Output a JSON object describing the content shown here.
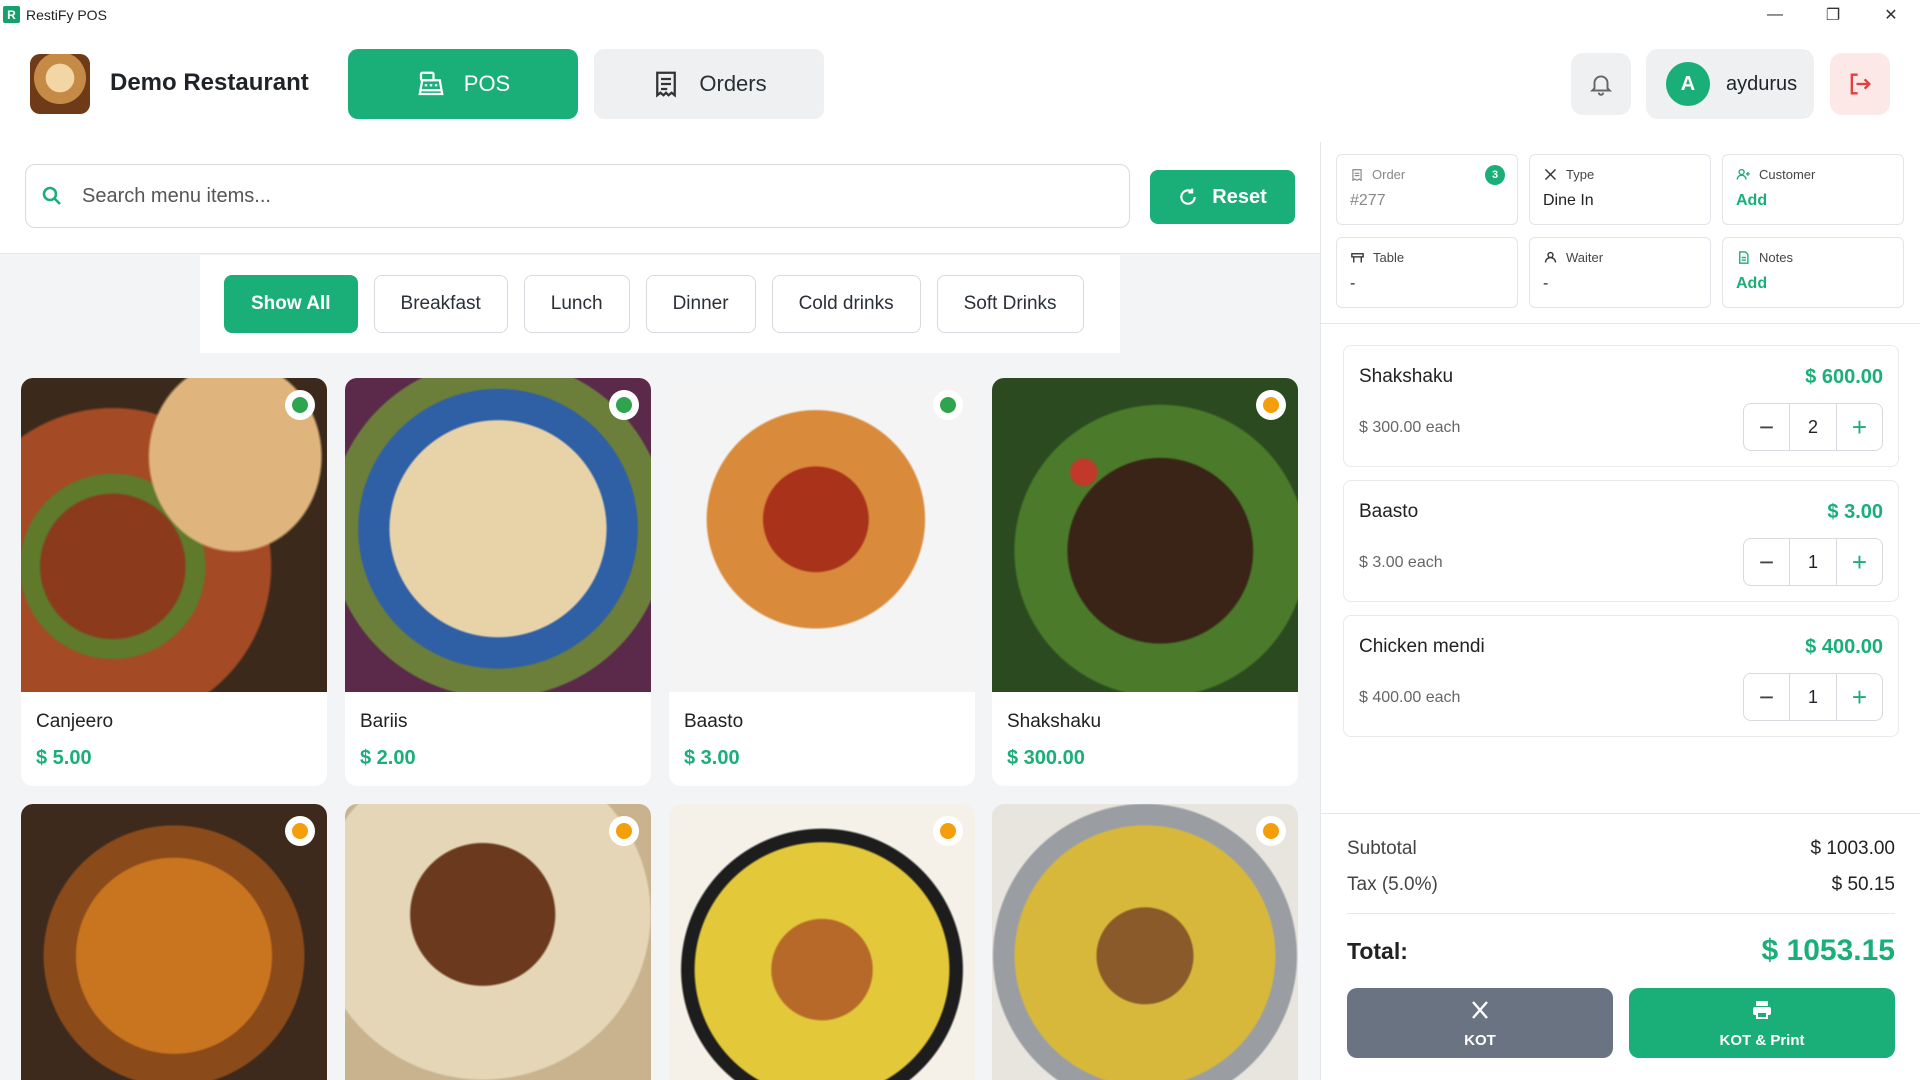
{
  "window": {
    "title": "RestiFy POS",
    "logo_letter": "R"
  },
  "header": {
    "restaurant_name": "Demo Restaurant",
    "nav": {
      "pos_label": "POS",
      "orders_label": "Orders"
    },
    "user": {
      "avatar_letter": "A",
      "name": "aydurus"
    }
  },
  "search": {
    "placeholder": "Search menu items...",
    "value": ""
  },
  "reset_label": "Reset",
  "categories": [
    "Show All",
    "Breakfast",
    "Lunch",
    "Dinner",
    "Cold drinks",
    "Soft Drinks"
  ],
  "active_category": "Show All",
  "menu_items": [
    {
      "name": "Canjeero",
      "price": "$ 5.00",
      "indicator_color": "#2ea44f"
    },
    {
      "name": "Bariis",
      "price": "$ 2.00",
      "indicator_color": "#2ea44f"
    },
    {
      "name": "Baasto",
      "price": "$ 3.00",
      "indicator_color": "#2ea44f"
    },
    {
      "name": "Shakshaku",
      "price": "$ 300.00",
      "indicator_color": "#f59e0b"
    },
    {
      "name": "",
      "price": "",
      "indicator_color": "#f59e0b"
    },
    {
      "name": "",
      "price": "",
      "indicator_color": "#f59e0b"
    },
    {
      "name": "",
      "price": "",
      "indicator_color": "#f59e0b"
    },
    {
      "name": "",
      "price": "",
      "indicator_color": "#f59e0b"
    }
  ],
  "order_info": {
    "order": {
      "label": "Order",
      "value": "#277",
      "badge": "3"
    },
    "type": {
      "label": "Type",
      "value": "Dine In"
    },
    "customer": {
      "label": "Customer",
      "value": "Add"
    },
    "table": {
      "label": "Table",
      "value": "-"
    },
    "waiter": {
      "label": "Waiter",
      "value": "-"
    },
    "notes": {
      "label": "Notes",
      "value": "Add"
    }
  },
  "cart": [
    {
      "name": "Shakshaku",
      "total": "$ 600.00",
      "each": "$ 300.00 each",
      "qty": "2"
    },
    {
      "name": "Baasto",
      "total": "$ 3.00",
      "each": "$ 3.00 each",
      "qty": "1"
    },
    {
      "name": "Chicken mendi",
      "total": "$ 400.00",
      "each": "$ 400.00 each",
      "qty": "1"
    }
  ],
  "totals": {
    "subtotal_label": "Subtotal",
    "subtotal": "$ 1003.00",
    "tax_label": "Tax (5.0%)",
    "tax": "$ 50.15",
    "total_label": "Total:",
    "total": "$ 1053.15"
  },
  "actions": {
    "kot_label": "KOT",
    "print_label": "KOT & Print"
  },
  "colors": {
    "accent": "#1aae79",
    "kot_button": "#6a7382",
    "logout_bg": "#fde8e8",
    "logout_icon": "#e53e3e"
  }
}
